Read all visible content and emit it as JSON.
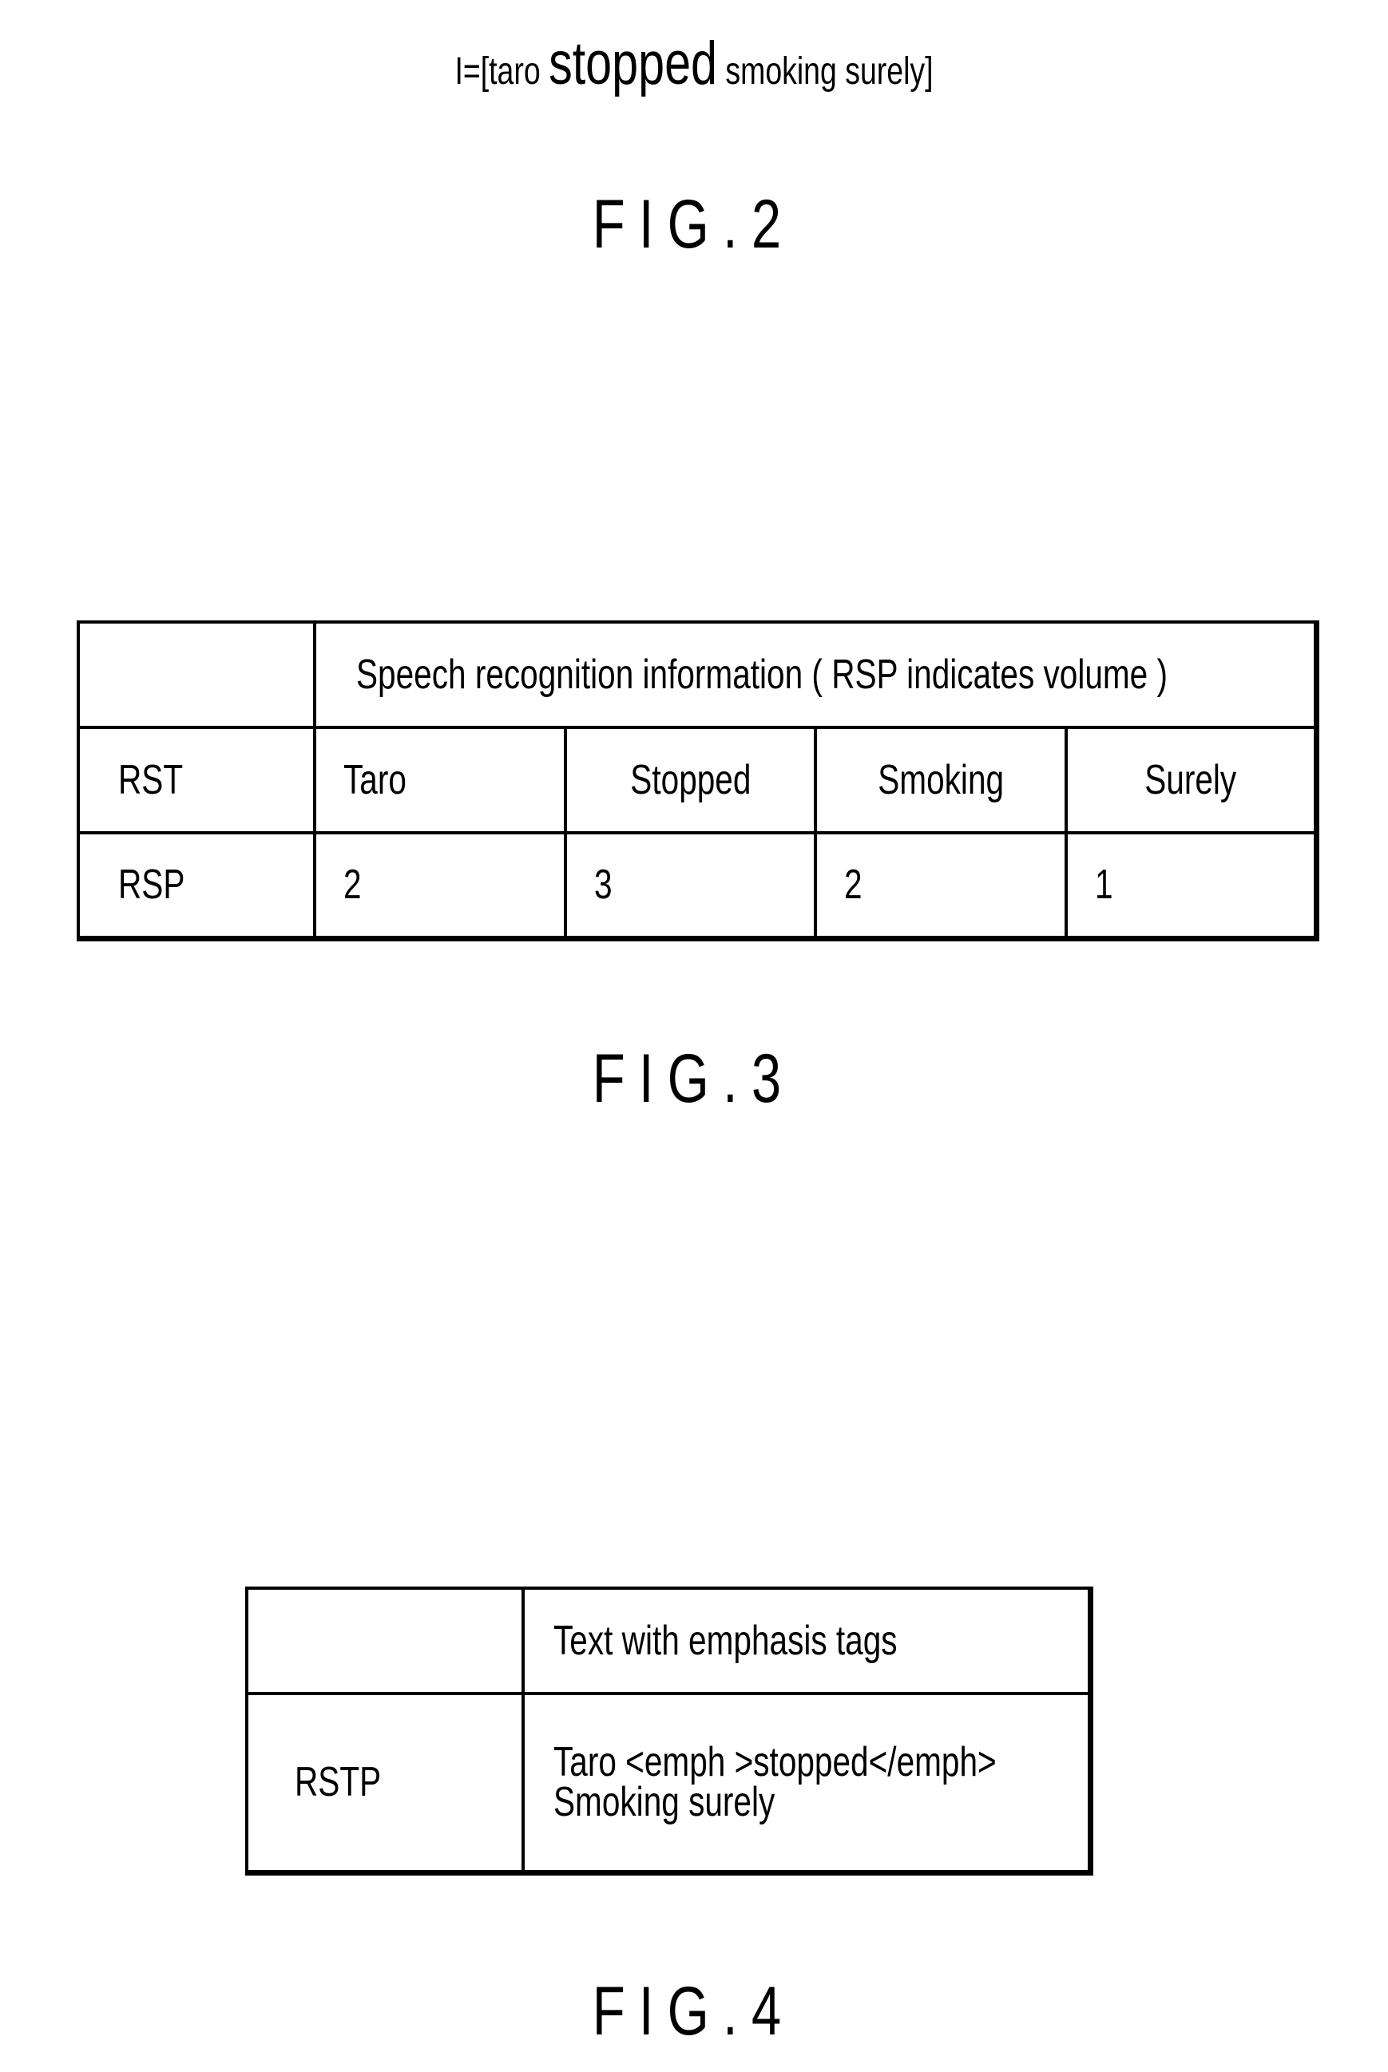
{
  "fig2": {
    "sentence_prefix": "I=[taro ",
    "sentence_emphasized": "stopped",
    "sentence_suffix": " smoking surely]",
    "label": "FIG.2"
  },
  "fig3": {
    "header": "Speech recognition information ( RSP indicates volume )",
    "rows": [
      {
        "label": "RST",
        "cells": [
          "Taro",
          "Stopped",
          "Smoking",
          "Surely"
        ]
      },
      {
        "label": "RSP",
        "cells": [
          "2",
          "3",
          "2",
          "1"
        ]
      }
    ],
    "label": "FIG.3"
  },
  "fig4": {
    "header": "Text with emphasis tags",
    "row_label": "RSTP",
    "row_value_line1": "Taro <emph >stopped</emph>",
    "row_value_line2": "Smoking surely",
    "label": "FIG.4"
  }
}
